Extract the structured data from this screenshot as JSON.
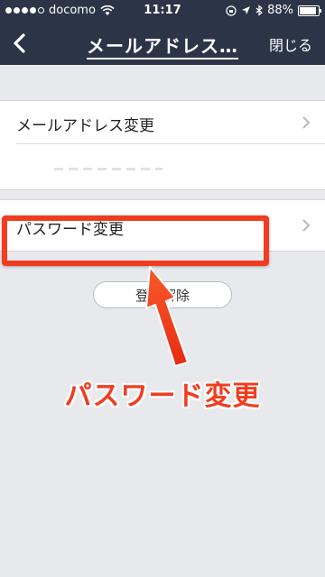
{
  "status": {
    "carrier": "docomo",
    "time": "11:17",
    "battery": "88%",
    "battery_level": 0.88,
    "signal_bars": 4
  },
  "nav": {
    "title": "メールアドレス…",
    "close_label": "閉じる"
  },
  "list": {
    "email_change_label": "メールアドレス変更",
    "password_change_label": "パスワード変更"
  },
  "unregister_label": "登録解除",
  "annotation": {
    "callout_text": "パスワード変更",
    "color": "#f23c1f"
  },
  "colors": {
    "nav_bg": "#2c3548",
    "page_bg": "#e8e9ec"
  },
  "icons": [
    "wifi-icon",
    "lock-rotation-icon",
    "location-icon",
    "bluetooth-icon",
    "back-chevron-icon",
    "chevron-right-icon",
    "arrow-icon"
  ]
}
